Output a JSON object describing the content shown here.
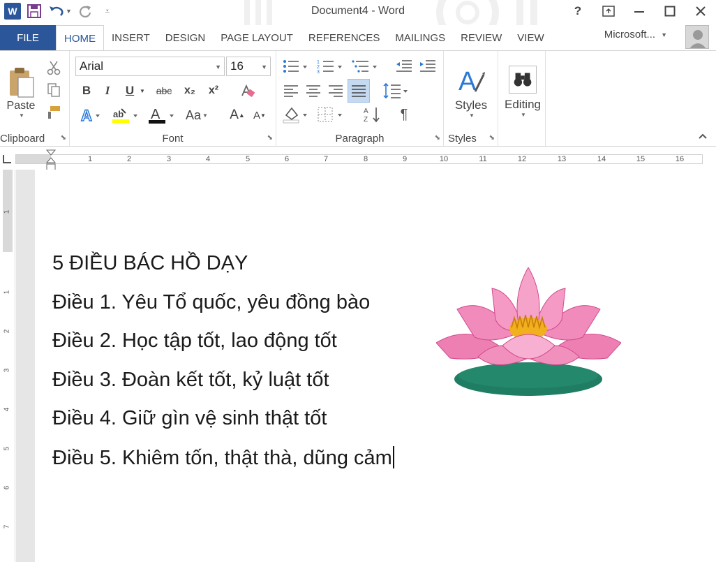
{
  "window": {
    "title": "Document4 - Word",
    "help_label": "?",
    "app_badge": "W"
  },
  "tabs": [
    {
      "label": "FILE"
    },
    {
      "label": "HOME"
    },
    {
      "label": "INSERT"
    },
    {
      "label": "DESIGN"
    },
    {
      "label": "PAGE LAYOUT"
    },
    {
      "label": "REFERENCES"
    },
    {
      "label": "MAILINGS"
    },
    {
      "label": "REVIEW"
    },
    {
      "label": "VIEW"
    }
  ],
  "account": {
    "name": "Microsoft..."
  },
  "ribbon": {
    "clipboard": {
      "group_label": "Clipboard",
      "paste_label": "Paste"
    },
    "font": {
      "group_label": "Font",
      "font_name": "Arial",
      "font_size": "16",
      "bold": "B",
      "italic": "I",
      "underline": "U",
      "strikethrough": "abc",
      "subscript": "x₂",
      "superscript": "x²",
      "change_case": "Aa",
      "grow": "A",
      "shrink": "A"
    },
    "paragraph": {
      "group_label": "Paragraph",
      "pilcrow": "¶"
    },
    "styles": {
      "group_label": "Styles",
      "styles_label": "Styles"
    },
    "editing": {
      "editing_label": "Editing"
    }
  },
  "ruler": {
    "numbers": [
      "1",
      "2",
      "3",
      "4",
      "5",
      "6",
      "7",
      "8",
      "9",
      "10",
      "11",
      "12",
      "13",
      "14",
      "15",
      "16"
    ],
    "vertical_numbers": [
      "1",
      "1",
      "2",
      "3",
      "4",
      "5",
      "6",
      "7"
    ]
  },
  "document": {
    "lines": [
      "5 ĐIỀU BÁC HỒ DẠY",
      "Điều 1. Yêu Tổ quốc, yêu đồng bào",
      "Điều 2. Học tập tốt, lao động tốt",
      "Điều 3. Đoàn kết tốt, kỷ luật tốt",
      "Điều 4. Giữ gìn vệ sinh thật tốt",
      "Điều 5. Khiêm tốn, thật thà, dũng cảm"
    ]
  },
  "colors": {
    "accent": "#2b579a",
    "lotus_pink": "#e8609e",
    "lotus_leaf": "#1e7d63",
    "lotus_center": "#f2b01e"
  }
}
